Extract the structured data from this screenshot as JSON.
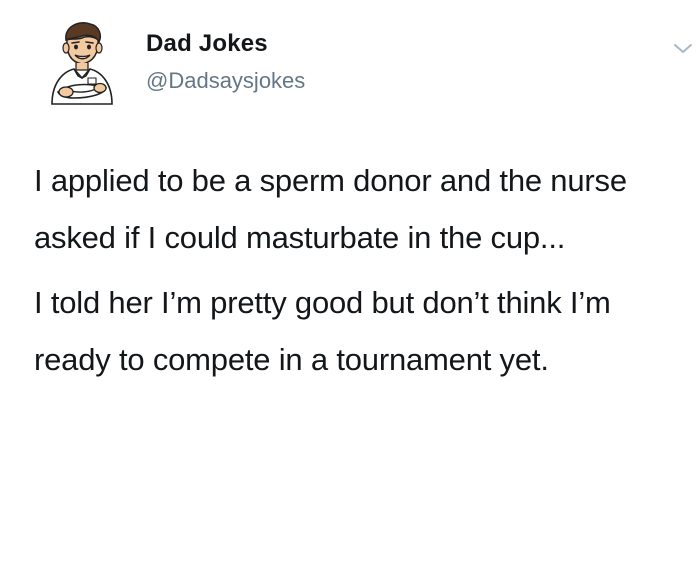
{
  "tweet": {
    "author": {
      "display_name": "Dad Jokes",
      "handle": "@Dadsaysjokes",
      "avatar_icon": "cartoon-dad-avatar-icon"
    },
    "menu_icon": "chevron-down-icon",
    "paragraphs": [
      "I applied to be a sperm donor and the nurse asked if I could masturbate in the cup...",
      "I told her I’m pretty good but don’t think I’m ready to compete in a tournament yet."
    ]
  },
  "colors": {
    "text": "#14171a",
    "secondary": "#657786",
    "chevron": "#aab8c2",
    "background": "#ffffff"
  }
}
